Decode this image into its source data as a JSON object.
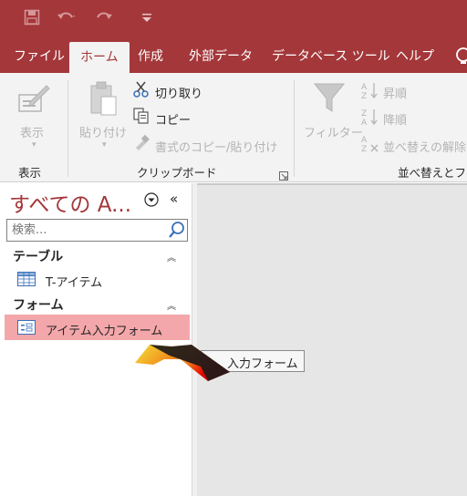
{
  "ribbon_tabs": [
    {
      "label": "ファイル"
    },
    {
      "label": "ホーム"
    },
    {
      "label": "作成"
    },
    {
      "label": "外部データ"
    },
    {
      "label": "データベース ツール"
    },
    {
      "label": "ヘルプ"
    }
  ],
  "active_tab": "ホーム",
  "ribbon": {
    "view_group": {
      "button_label": "表示",
      "group_label": "表示"
    },
    "clipboard_group": {
      "paste_label": "貼り付け",
      "cut_label": "切り取り",
      "copy_label": "コピー",
      "format_painter_label": "書式のコピー/貼り付け",
      "group_label": "クリップボード"
    },
    "sort_filter_group": {
      "filter_label": "フィルター",
      "ascending_label": "昇順",
      "descending_label": "降順",
      "clear_sort_label": "並べ替えの解除",
      "group_label": "並べ替えとフィ"
    }
  },
  "nav_pane": {
    "title": "すべての A...",
    "search_placeholder": "検索...",
    "sections": [
      {
        "header": "テーブル",
        "items": [
          {
            "label": "T-アイテム"
          }
        ]
      },
      {
        "header": "フォーム",
        "items": [
          {
            "label": "アイテム入力フォーム"
          }
        ]
      }
    ]
  },
  "drag_tooltip": "入力フォーム",
  "colors": {
    "accent": "#a4373a",
    "selected_item": "#f4a7aa",
    "ribbon_bg": "#f3f3f3",
    "workspace_bg": "#e6e6e6"
  },
  "icons": [
    "save-icon",
    "undo-icon",
    "redo-icon",
    "customize-qat-icon",
    "lightbulb-icon",
    "design-view-icon",
    "paste-icon",
    "cut-icon",
    "copy-icon",
    "format-painter-icon",
    "filter-icon",
    "sort-ascending-icon",
    "sort-descending-icon",
    "clear-sort-icon",
    "search-icon",
    "table-icon",
    "form-icon",
    "drag-arrow-icon"
  ]
}
